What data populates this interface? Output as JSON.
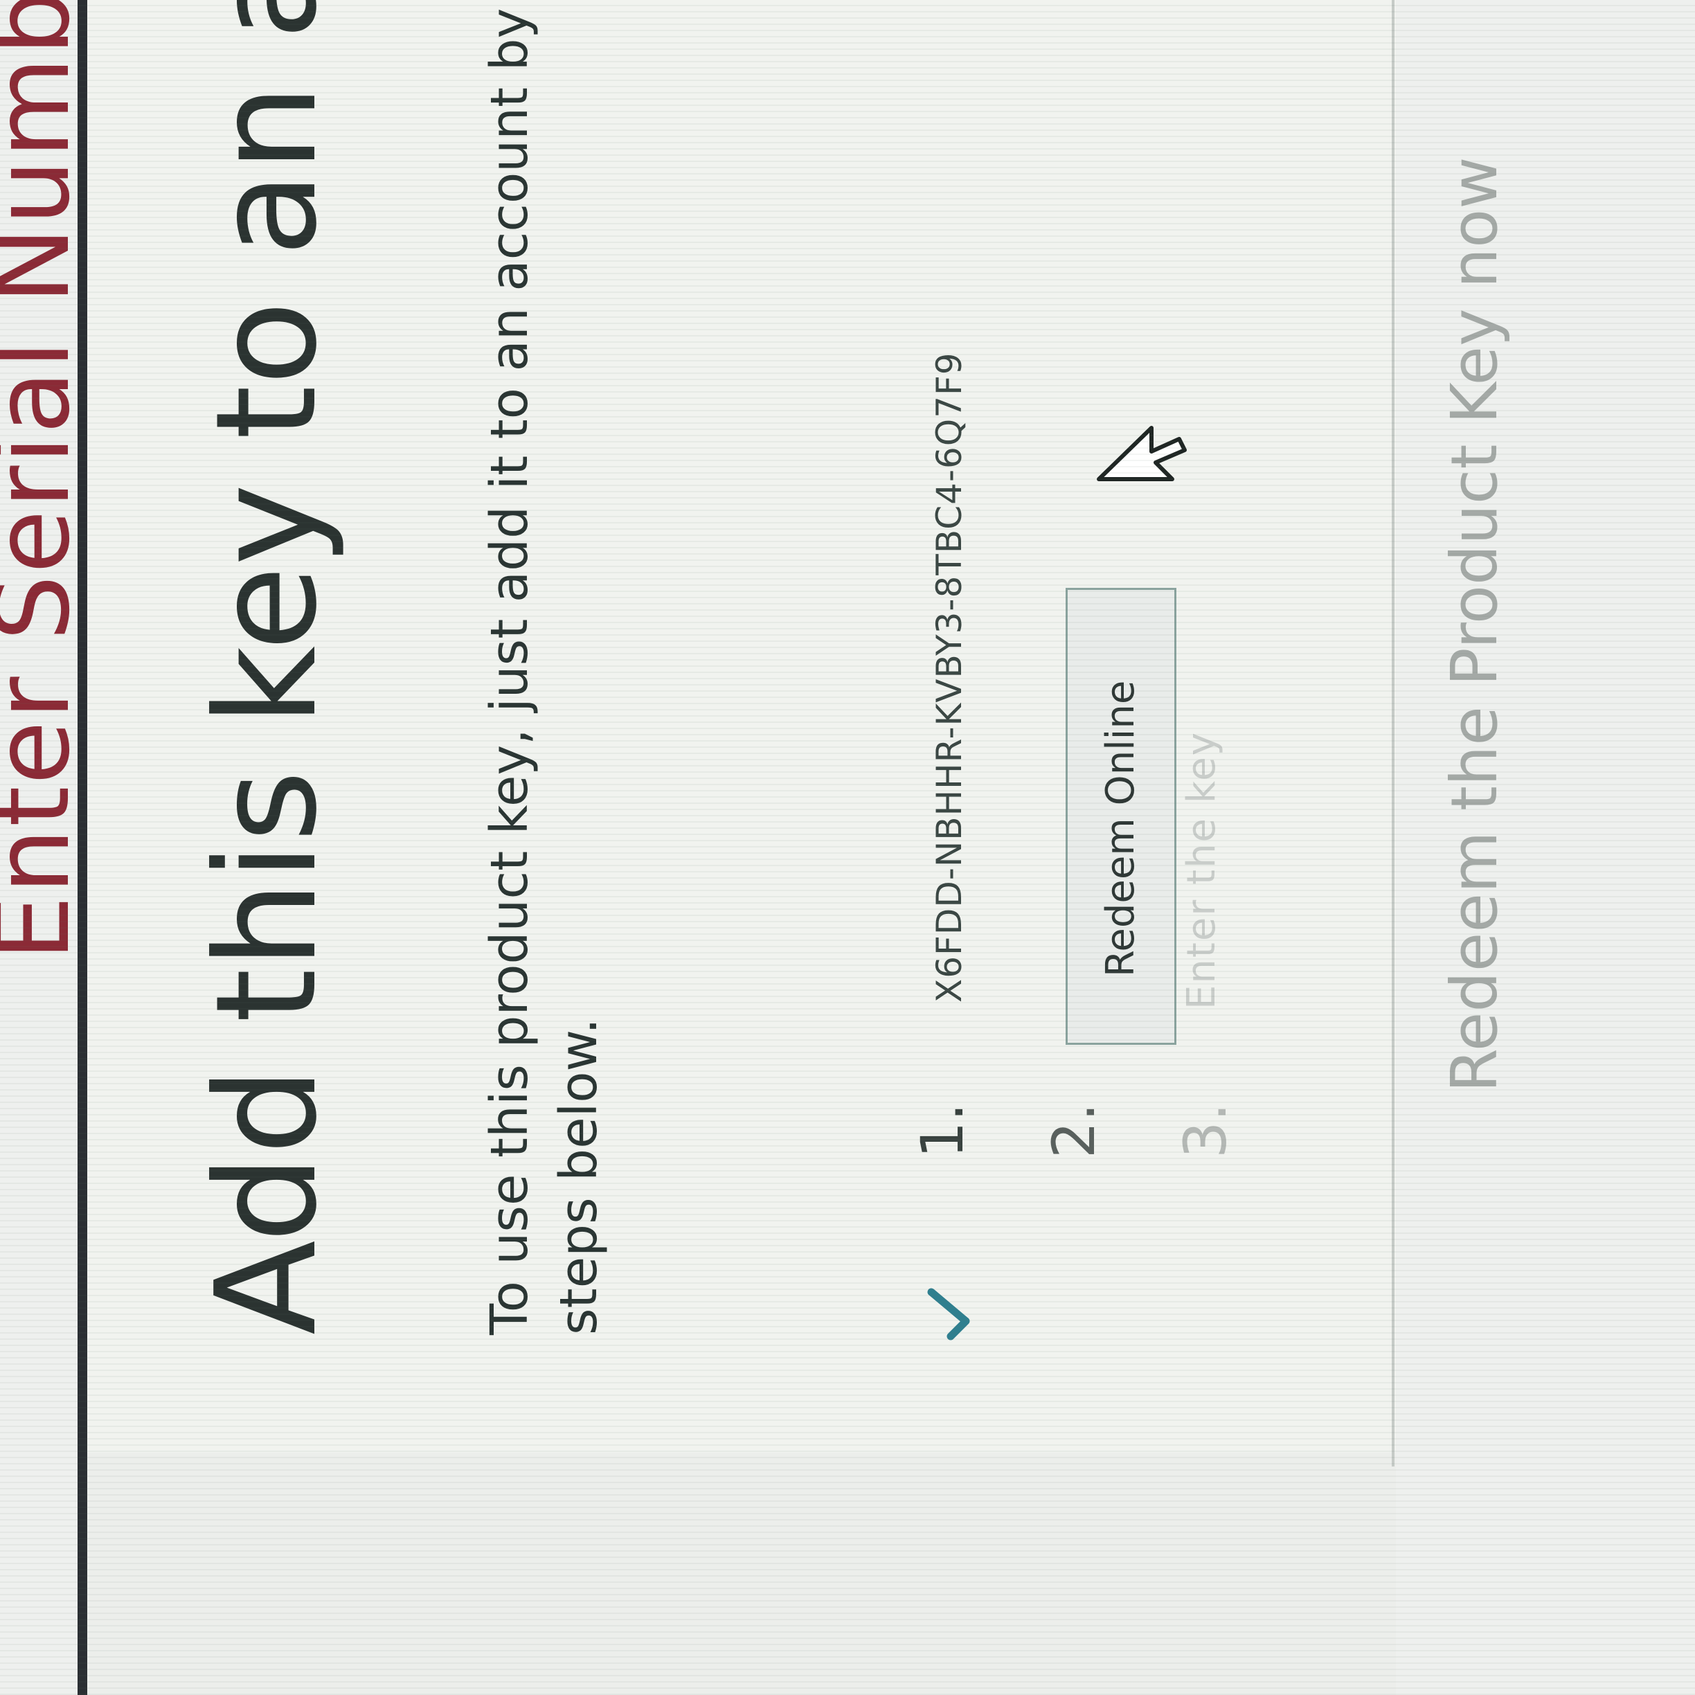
{
  "background": {
    "title": "Enter Serial Number"
  },
  "dialog": {
    "title": "Add this key to an account",
    "description_line1": "To use this product key, just add it to an account by following the",
    "description_line2": "steps below.",
    "steps": [
      {
        "number": "1.",
        "value": "X6FDD-NBHHR-KVBY3-8TBC4-6Q7F9",
        "completed": true
      },
      {
        "number": "2.",
        "button_label": "Redeem Online"
      },
      {
        "number": "3.",
        "label": "Enter the key"
      }
    ],
    "redeem_now_link": "Redeem the Product Key now"
  },
  "colors": {
    "accent_check": "#2f7f8f",
    "backdrop_title": "#8b2a36"
  }
}
